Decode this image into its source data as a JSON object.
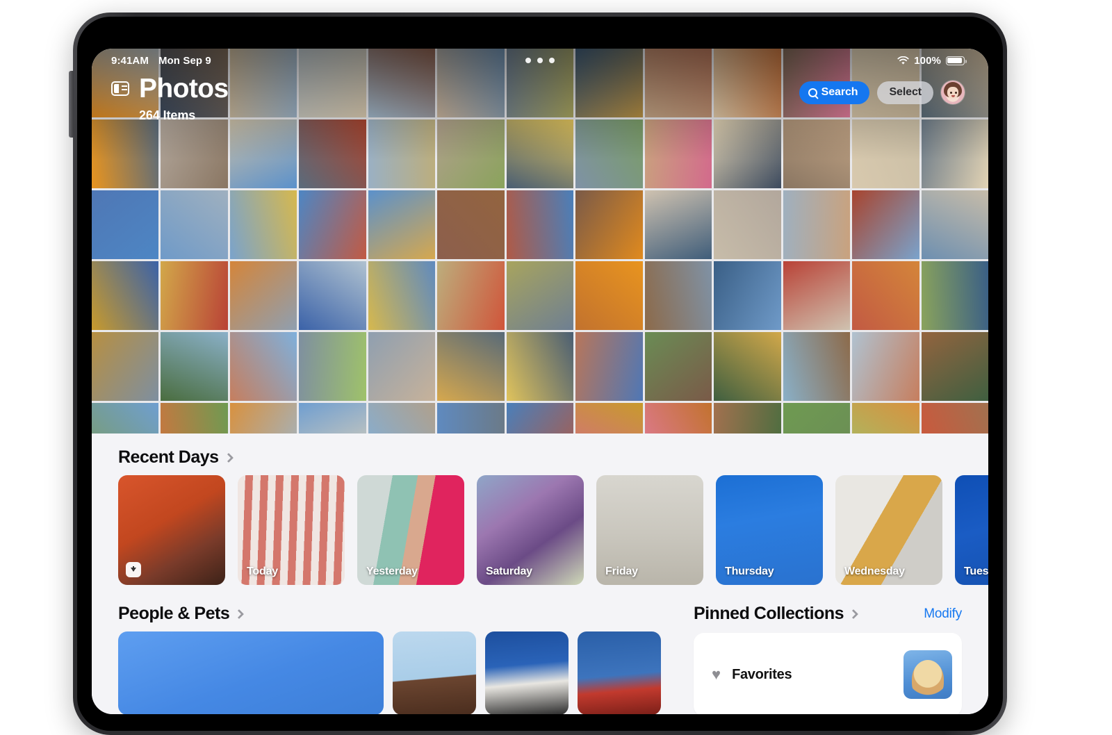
{
  "status_bar": {
    "time": "9:41AM",
    "date": "Mon Sep 9",
    "wifi_icon": "wifi-icon",
    "battery_percent": "100%",
    "battery_icon": "battery-full-icon"
  },
  "nav": {
    "sidebar_icon": "sidebar-toggle-icon",
    "title": "Photos",
    "item_count": "264 Items",
    "search_label": "Search",
    "search_icon": "search-icon",
    "select_label": "Select",
    "avatar_name": "user-avatar",
    "accent_blue": "#1577f0",
    "select_bg": "#d7d9de"
  },
  "recent_days": {
    "title": "Recent Days",
    "chevron_icon": "chevron-right-icon",
    "save_badge_icon": "download-icon",
    "cards": [
      {
        "label": "",
        "name": "day-card-portrait",
        "has_save_badge": true,
        "bg": "linear-gradient(150deg,#d8552c 0%,#c2471f 42%,#7a3b2a 70%,#3c2218 100%)"
      },
      {
        "label": "Today",
        "name": "day-card-today",
        "has_save_badge": false,
        "bg": "repeating-linear-gradient(92deg,#f0e6e2 0 11px,#d4776c 11px 22px)"
      },
      {
        "label": "Yesterday",
        "name": "day-card-yesterday",
        "has_save_badge": false,
        "bg": "linear-gradient(100deg,#cfd9d6 0 28%,#8fc2b3 28% 48%,#d9a88e 48% 62%,#e0245e 62% 100%)"
      },
      {
        "label": "Saturday",
        "name": "day-card-saturday",
        "has_save_badge": false,
        "bg": "linear-gradient(145deg,#8fa6c8 0%,#9c77b0 35%,#6b4b86 62%,#cfd9b8 100%)"
      },
      {
        "label": "Friday",
        "name": "day-card-friday",
        "has_save_badge": false,
        "bg": "linear-gradient(180deg,#d8d6cf 0%,#c9c6bd 55%,#b9b5aa 100%)"
      },
      {
        "label": "Thursday",
        "name": "day-card-thursday",
        "has_save_badge": false,
        "bg": "linear-gradient(170deg,#1c6fd4 0%,#2b7de0 40%,#2a72cf 100%)"
      },
      {
        "label": "Wednesday",
        "name": "day-card-wednesday",
        "has_save_badge": false,
        "bg": "linear-gradient(120deg,#e9e7e2 0 40%,#d9a74a 40% 64%,#cfcdc8 64% 100%)"
      },
      {
        "label": "Tuesday",
        "name": "day-card-tuesday",
        "has_save_badge": false,
        "bg": "linear-gradient(165deg,#0f4fb5 0%,#1a5cc4 45%,#1550ae 100%)"
      }
    ]
  },
  "people_pets": {
    "title": "People & Pets",
    "chevron_icon": "chevron-right-icon",
    "cards": [
      {
        "name": "people-card-featured",
        "bg": ""
      },
      {
        "name": "people-card-person",
        "bg": "linear-gradient(175deg,#bcd8ee 0%,#a9cde8 55%,#6b4530 56%,#4a2d1e 100%)"
      },
      {
        "name": "people-card-dog",
        "bg": "linear-gradient(175deg,#1d4f9e 0%,#2a63b8 40%,#e8e6e1 62%,#2a2a2a 100%)"
      },
      {
        "name": "people-card-person-2",
        "bg": "linear-gradient(175deg,#2a5fa8 0%,#3d74bd 52%,#c23a2e 70%,#7a1f18 100%)"
      }
    ]
  },
  "pinned_collections": {
    "title": "Pinned Collections",
    "chevron_icon": "chevron-right-icon",
    "modify_label": "Modify",
    "items": [
      {
        "label": "Favorites",
        "icon": "heart-icon",
        "icon_glyph": "♥"
      }
    ]
  },
  "photo_grid": {
    "columns": 13,
    "rows": 6,
    "colors": [
      "#e08a1e",
      "#3c4a5e",
      "#c9b79a",
      "#b9c3c8",
      "#9fb6c9",
      "#c7b29a",
      "#6e7f92",
      "#3f5d7a",
      "#c2a485",
      "#dfc9a8",
      "#7e6a57",
      "#e3d4b8",
      "#586a78",
      "#e8941f",
      "#b2a79c",
      "#cbbfa6",
      "#5a6b7c",
      "#9ab0c4",
      "#b0a08c",
      "#4a5e73",
      "#7f92a6",
      "#c9a27e",
      "#e2d3b4",
      "#8a7662",
      "#d8c9ae",
      "#6b7a88",
      "#4f77b5",
      "#6f9ac8",
      "#7aa3cc",
      "#4d86c4",
      "#5b91cb",
      "#8c5f4d",
      "#b05a46",
      "#7a5a48",
      "#cfc2b0",
      "#c7bca9",
      "#9fb0bf",
      "#a8442e",
      "#6d8fb0",
      "#c89a2c",
      "#d2a84a",
      "#d4853a",
      "#3b62a8",
      "#d6b84e",
      "#bcae7d",
      "#a8a45e",
      "#c2722e",
      "#8c6a4a",
      "#3a5f86",
      "#b94236",
      "#c25a43",
      "#8aa35c",
      "#b78f42",
      "#4a6d3f",
      "#c67e5e",
      "#7e8fa0",
      "#8f9fb0",
      "#d6a84e",
      "#e0c35c",
      "#b8765a",
      "#6a8c55",
      "#3f5f40",
      "#8ab0c8",
      "#b0c2d0",
      "#93643f",
      "#7a9c66",
      "#c9763f",
      "#d8913f",
      "#6f9ed0",
      "#7fb0dc",
      "#5f8abf",
      "#4a7fba",
      "#d36a8c",
      "#e07a9a",
      "#a2714f",
      "#6f9a52",
      "#9fc26a",
      "#d0553a"
    ]
  }
}
